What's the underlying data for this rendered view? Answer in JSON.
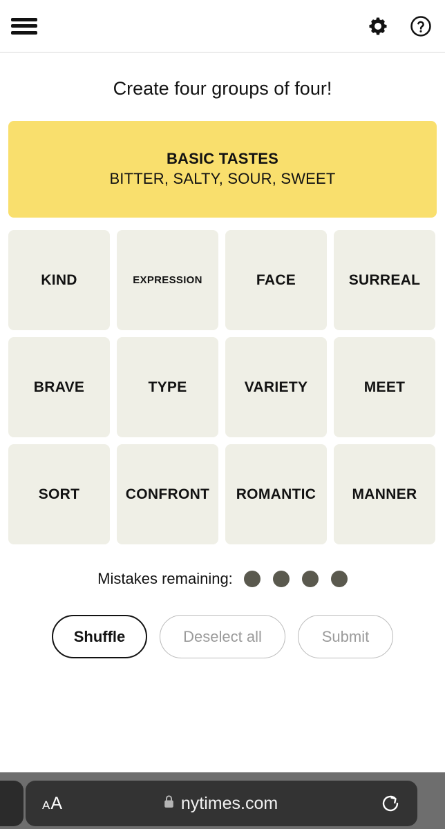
{
  "header": {
    "menu_icon": "hamburger-menu-icon",
    "settings_icon": "gear-icon",
    "help_icon": "help-circle-icon"
  },
  "board": {
    "title": "Create four groups of four!",
    "solved_groups": [
      {
        "category": "BASIC TASTES",
        "words_line": "BITTER, SALTY, SOUR, SWEET",
        "color": "#f9df6d"
      }
    ],
    "tile_bg": "#efefe6",
    "tiles": [
      {
        "label": "KIND",
        "size": "normal"
      },
      {
        "label": "EXPRESSION",
        "size": "small"
      },
      {
        "label": "FACE",
        "size": "normal"
      },
      {
        "label": "SURREAL",
        "size": "normal"
      },
      {
        "label": "BRAVE",
        "size": "normal"
      },
      {
        "label": "TYPE",
        "size": "normal"
      },
      {
        "label": "VARIETY",
        "size": "normal"
      },
      {
        "label": "MEET",
        "size": "normal"
      },
      {
        "label": "SORT",
        "size": "normal"
      },
      {
        "label": "CONFRONT",
        "size": "normal"
      },
      {
        "label": "ROMANTIC",
        "size": "normal"
      },
      {
        "label": "MANNER",
        "size": "normal"
      }
    ]
  },
  "mistakes": {
    "label": "Mistakes remaining:",
    "remaining": 4,
    "dot_color": "#5a594e"
  },
  "actions": {
    "shuffle_label": "Shuffle",
    "deselect_label": "Deselect all",
    "submit_label": "Submit",
    "shuffle_enabled": true,
    "deselect_enabled": false,
    "submit_enabled": false
  },
  "browser": {
    "text_size_small": "A",
    "text_size_large": "A",
    "lock_icon": "lock-icon",
    "url": "nytimes.com",
    "reload_icon": "reload-icon"
  }
}
